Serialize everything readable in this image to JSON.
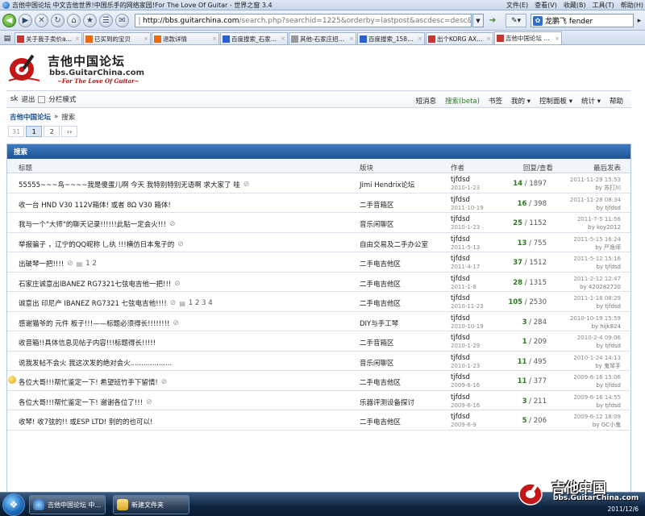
{
  "browser": {
    "title": "吉他中国论坛  中文吉他世界!中国乐手的网络家园!For The Love Of Guitar - 世界之窗 3.4",
    "menu": [
      "文件(E)",
      "查看(V)",
      "收藏(B)",
      "工具(T)",
      "帮助(H)"
    ],
    "url_host": "http://bbs.guitarchina.com",
    "url_rest": "/search.php?searchid=1225&orderby=lastpost&ascdesc=desc&sear",
    "search_value": "龙鹏飞 fender",
    "tabs": [
      {
        "label": "关于我于卖价ak设..."
      },
      {
        "label": "已买到的宝贝"
      },
      {
        "label": "退款详情"
      },
      {
        "label": "百度搜索_石家庄 醒..."
      },
      {
        "label": "其他-石家庄招聘训..."
      },
      {
        "label": "百度搜索_1583196..."
      },
      {
        "label": "出个KORG AX150..."
      },
      {
        "label": "吉他中国论坛 中..."
      }
    ]
  },
  "site": {
    "logo_cn": "吉他中国论坛",
    "logo_url": "bbs.GuitarChina.com",
    "logo_tag": "~For The Love Of Guitar~",
    "user": "sk",
    "logout": "退出",
    "split_mode": "分栏模式",
    "nav": [
      "短消息",
      "搜索(beta)",
      "书签",
      "我的",
      "控制面板",
      "统计",
      "帮助"
    ],
    "nav_dropdown_mark": "▾",
    "breadcrumb_home": "吉他中国论坛",
    "breadcrumb_sep": "»",
    "breadcrumb_current": "搜索"
  },
  "pager": {
    "total": "31",
    "pages": [
      "1",
      "2"
    ],
    "next": "››"
  },
  "table": {
    "title": "搜索",
    "headers": {
      "subject": "标题",
      "forum": "版块",
      "author": "作者",
      "counts": "回复/查看",
      "last": "最后发表"
    },
    "rows": [
      {
        "subject": "55555~~~鸟~~~~我是傻蛋儿啊  今天  我特别特别无语啊  求大家了  哇",
        "clip": true,
        "pages": "",
        "hot": false,
        "forum": "Jimi Hendrix论坛",
        "author": "tjfdsd",
        "date": "2010-1-23",
        "replies": "14",
        "views": "1897",
        "last_time": "2011-11-29 15:53",
        "last_by": "苏打川"
      },
      {
        "subject": "收一台  HND V30 112V箱体! 或者  8Ω V30 箱体!",
        "clip": false,
        "pages": "",
        "hot": false,
        "forum": "二手音箱区",
        "author": "tjfdsd",
        "date": "2011-10-19",
        "replies": "16",
        "views": "398",
        "last_time": "2011-11-28 08:34",
        "last_by": "tjfdsd"
      },
      {
        "subject": "我与一个\"大师\"的聊天记录!!!!!!此贴一定会火!!!",
        "clip": true,
        "pages": "",
        "hot": false,
        "forum": "音乐闲聊区",
        "author": "tjfdsd",
        "date": "2010-1-23",
        "replies": "25",
        "views": "1152",
        "last_time": "2011-7-5 11:56",
        "last_by": "koy2012"
      },
      {
        "subject": "举报骗子 ，辽宁的QQ昵称 乚纨   !!!横仿日本鬼子的",
        "clip": true,
        "pages": "",
        "hot": false,
        "forum": "自由交易及二手办公室",
        "author": "tjfdsd",
        "date": "2011-5-13",
        "replies": "13",
        "views": "755",
        "last_time": "2011-5-15 16:24",
        "last_by": "严逸师"
      },
      {
        "subject": "出破琴一把!!!!",
        "clip": true,
        "pages": "1  2",
        "hot": false,
        "forum": "二手电吉他区",
        "author": "tjfdsd",
        "date": "2011-4-17",
        "replies": "37",
        "views": "1512",
        "last_time": "2011-5-12 15:16",
        "last_by": "tjfdsd"
      },
      {
        "subject": "石家庄诚意出IBANEZ RG7321七弦电吉他一把!!!",
        "clip": true,
        "pages": "",
        "hot": false,
        "forum": "二手电吉他区",
        "author": "tjfdsd",
        "date": "2011-1-8",
        "replies": "28",
        "views": "1315",
        "last_time": "2011-2-12 12:47",
        "last_by": "420282720"
      },
      {
        "subject": "诚意出  印尼产  IBANEZ RG7321 七弦电吉他!!!!",
        "clip": true,
        "pages": "1  2  3  4",
        "hot": false,
        "forum": "二手电吉他区",
        "author": "tjfdsd",
        "date": "2010-11-23",
        "replies": "105",
        "views": "2530",
        "last_time": "2011-1-18 08:29",
        "last_by": "tjfdsd"
      },
      {
        "subject": "感谢猫爷的  元件  板子!!!——标题必须得长!!!!!!!!",
        "clip": true,
        "pages": "",
        "hot": false,
        "forum": "DIY与手工琴",
        "author": "tjfdsd",
        "date": "2010-10-19",
        "replies": "3",
        "views": "284",
        "last_time": "2010-10-19 15:59",
        "last_by": "hijk824"
      },
      {
        "subject": "收音箱!!具体信息见帖子内容!!!标题得长!!!!!",
        "clip": false,
        "pages": "",
        "hot": false,
        "forum": "二手音箱区",
        "author": "tjfdsd",
        "date": "2010-1-29",
        "replies": "1",
        "views": "209",
        "last_time": "2010-2-4 09:06",
        "last_by": "tjfdsd"
      },
      {
        "subject": "说我发帖不会火  我这次发的绝对会火...................",
        "clip": false,
        "pages": "",
        "hot": false,
        "forum": "音乐闲聊区",
        "author": "tjfdsd",
        "date": "2010-1-23",
        "replies": "11",
        "views": "495",
        "last_time": "2010-1-24 14:13",
        "last_by": "鬼琴手"
      },
      {
        "subject": "各位大哥!!!帮忙鉴定一下!  希望班竹手下留情!",
        "clip": true,
        "pages": "",
        "hot": true,
        "forum": "二手电吉他区",
        "author": "tjfdsd",
        "date": "2009-6-16",
        "replies": "11",
        "views": "377",
        "last_time": "2009-6-16 15:06",
        "last_by": "tjfdsd"
      },
      {
        "subject": "各位大哥!!!帮忙鉴定一下!  谢谢各位了!!!",
        "clip": true,
        "pages": "",
        "hot": false,
        "forum": "乐器评测设备探讨",
        "author": "tjfdsd",
        "date": "2009-6-16",
        "replies": "3",
        "views": "211",
        "last_time": "2009-6-16 14:55",
        "last_by": "tjfdsd"
      },
      {
        "subject": "收琴!  收7弦的!!  或ESP LTD!  别的的也可以!",
        "clip": false,
        "pages": "",
        "hot": false,
        "forum": "二手电吉他区",
        "author": "tjfdsd",
        "date": "2009-6-9",
        "replies": "5",
        "views": "206",
        "last_time": "2009-6-12 18:09",
        "last_by": "GC小鬼"
      }
    ]
  },
  "taskbar": {
    "tasks": [
      "吉他中国论坛  中...",
      "新建文件夹"
    ],
    "watermark_cn": "吉他中国",
    "watermark_url": "bbs.GuitarChina.com",
    "date": "2011/12/6"
  },
  "colors": {
    "header_blue": "#1f5596",
    "reply_green": "#2b7a1f",
    "logo_red": "#b01010"
  }
}
